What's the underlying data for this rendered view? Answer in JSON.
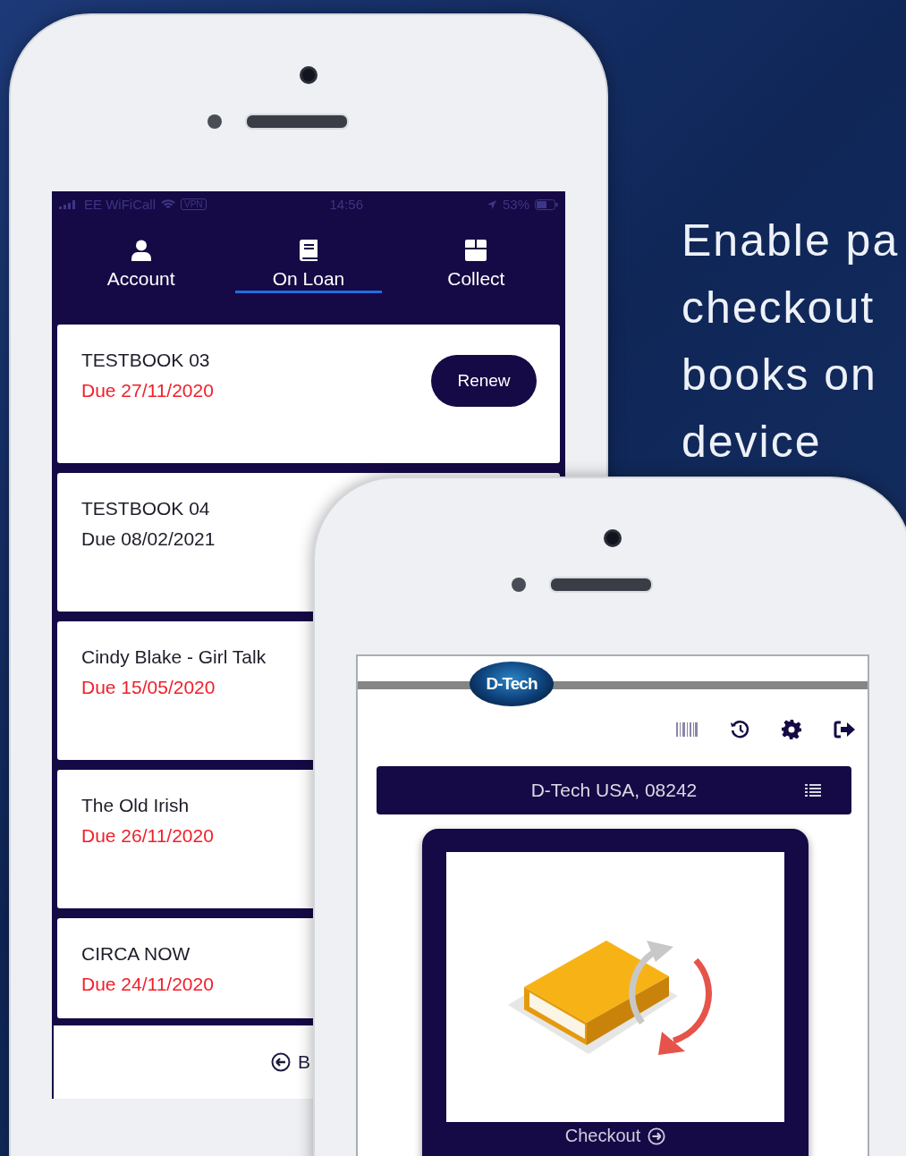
{
  "headline": {
    "lines": [
      "Enable pa",
      "checkout",
      "books on",
      "device"
    ]
  },
  "loans_phone": {
    "status_bar": {
      "carrier": "EE WiFiCall",
      "vpn": "VPN",
      "time": "14:56",
      "battery": "53%"
    },
    "tabs": [
      {
        "label": "Account",
        "kind": "person",
        "selected": false
      },
      {
        "label": "On Loan",
        "kind": "book",
        "selected": true
      },
      {
        "label": "Collect",
        "kind": "box",
        "selected": false
      }
    ],
    "loans": [
      {
        "title": "TESTBOOK 03",
        "due": "Due 27/11/2020",
        "overdue": true,
        "renew_button": "Renew"
      },
      {
        "title": "TESTBOOK 04",
        "due": "Due 08/02/2021",
        "overdue": false
      },
      {
        "title": "Cindy Blake - Girl Talk",
        "due": "Due 15/05/2020",
        "overdue": true
      },
      {
        "title": "The Old Irish",
        "due": "Due 26/11/2020",
        "overdue": true
      },
      {
        "title": "CIRCA NOW",
        "due": "Due 24/11/2020",
        "overdue": true
      }
    ],
    "bottom_button": {
      "label": "B"
    }
  },
  "checkout_phone": {
    "logo": "D-Tech",
    "location": "D-Tech USA, 08242",
    "checkout_button": "Checkout"
  }
}
